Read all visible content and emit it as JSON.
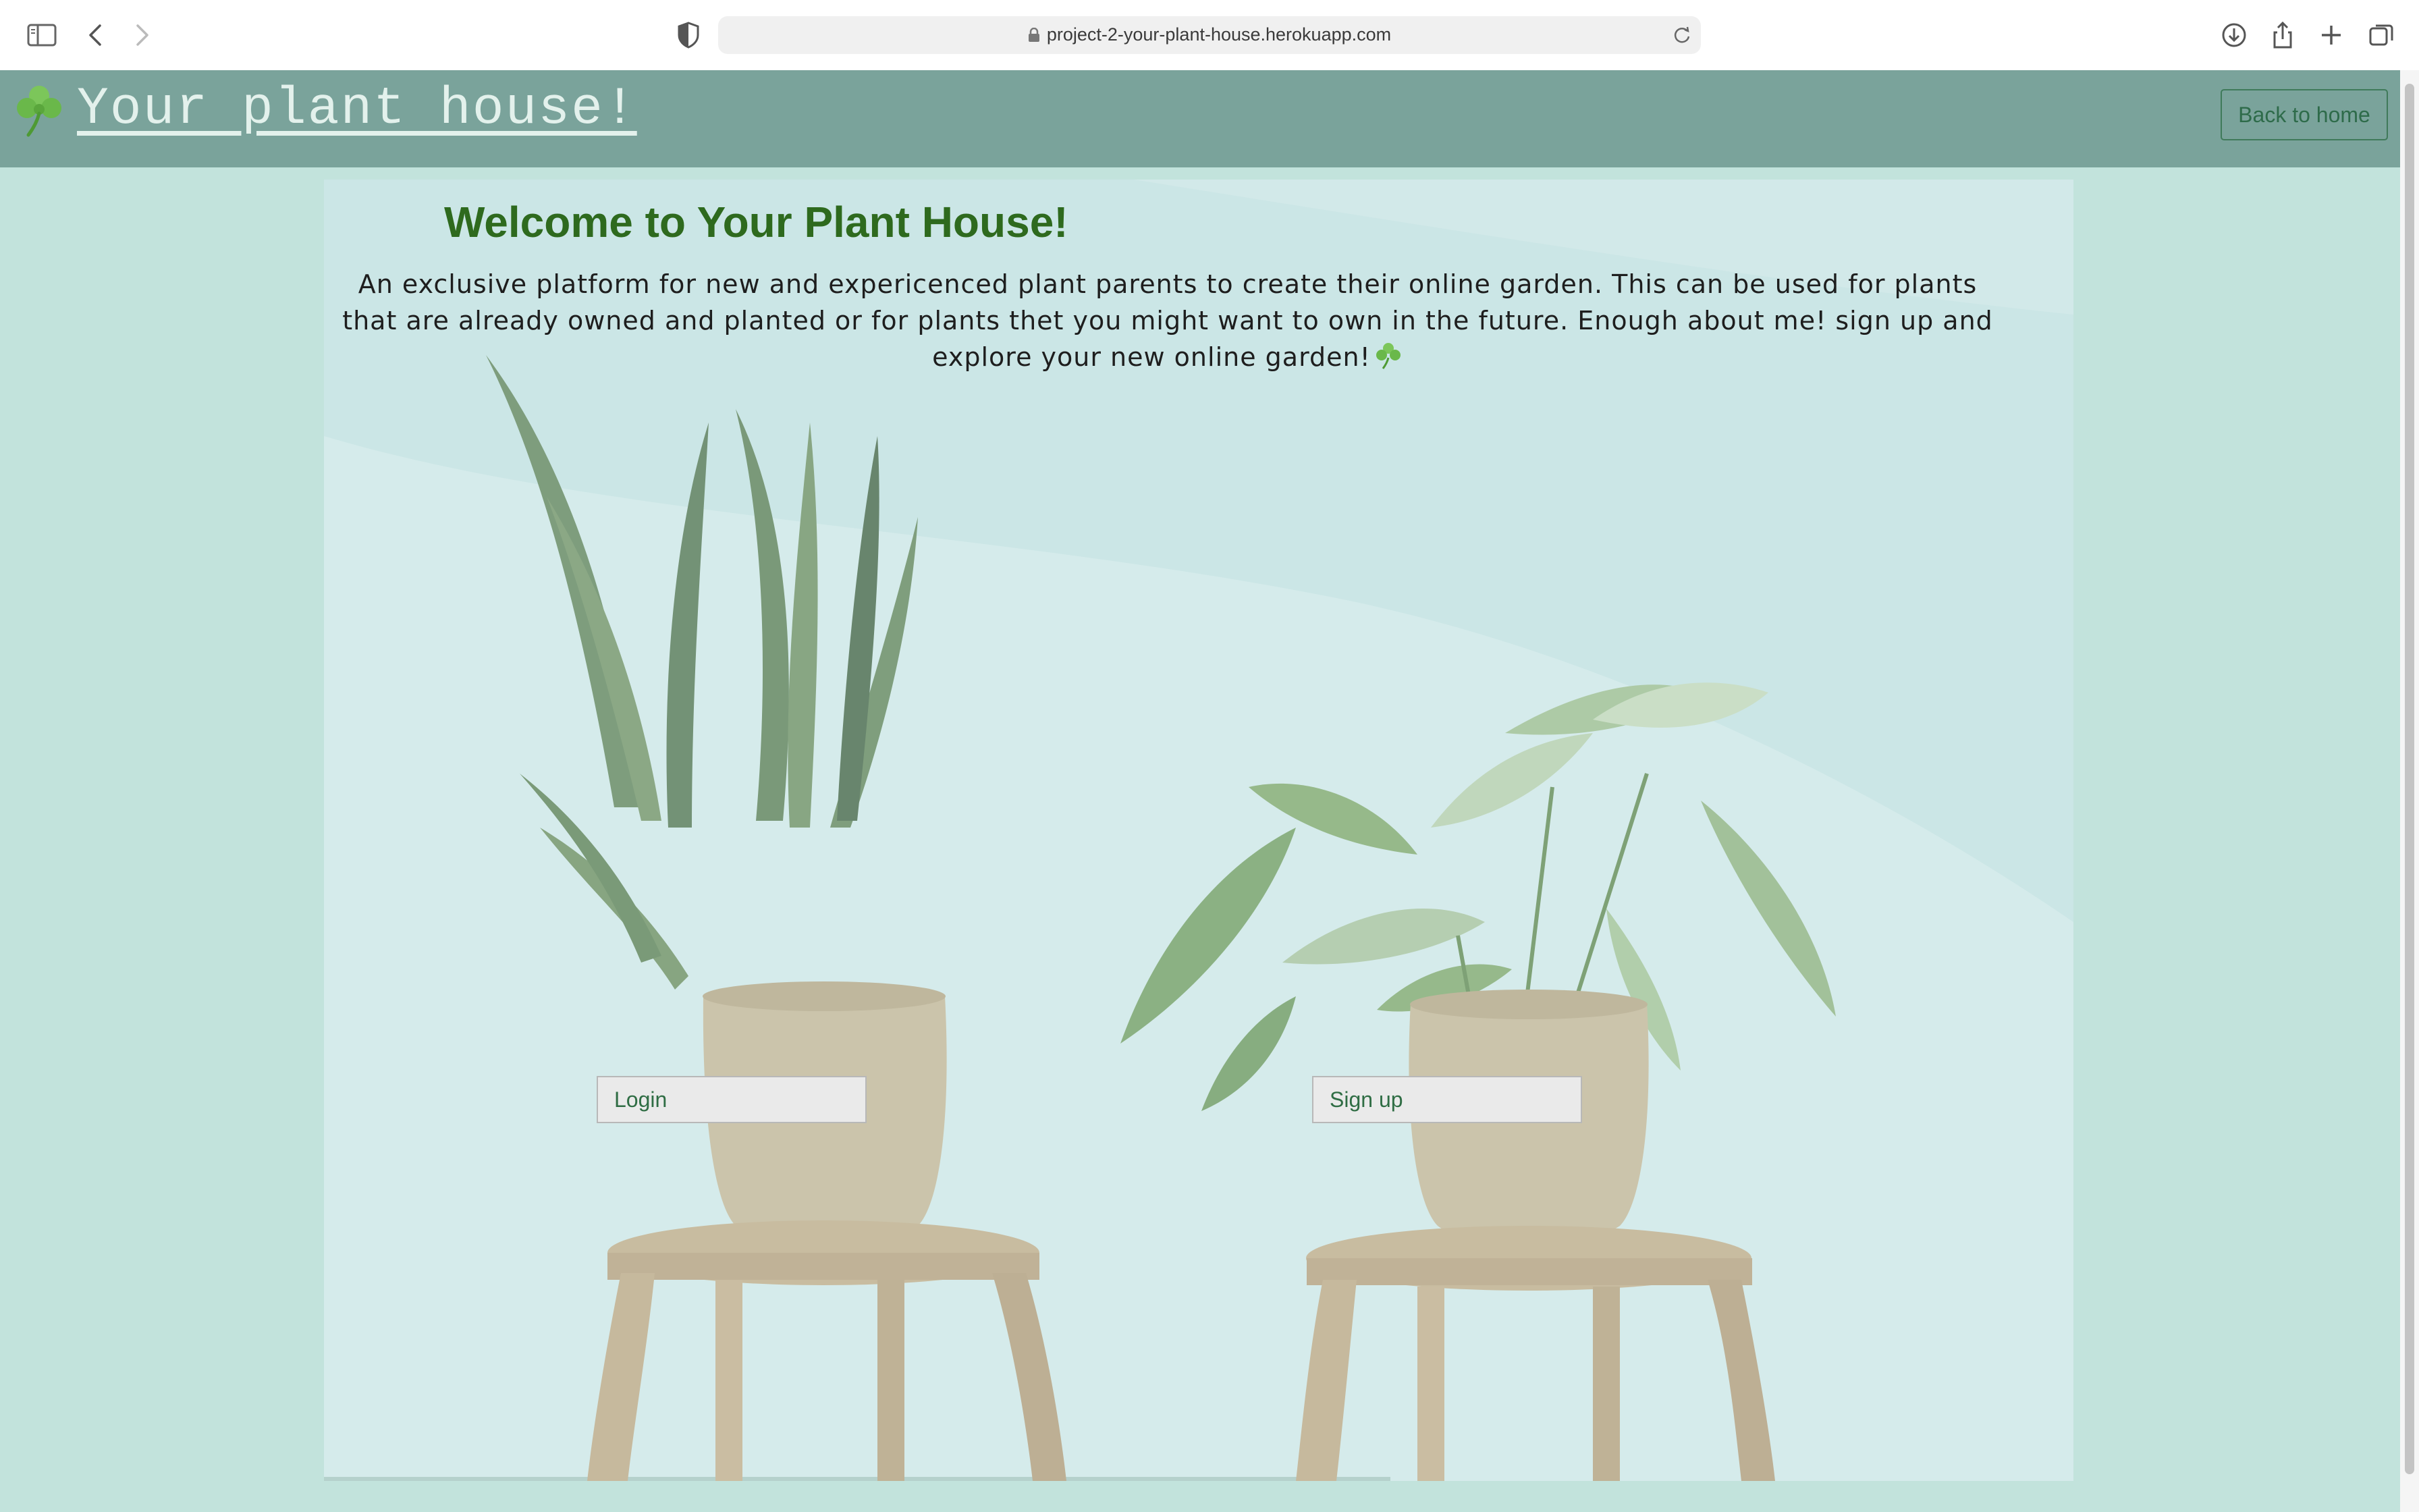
{
  "browser": {
    "url": "project-2-your-plant-house.herokuapp.com",
    "icons": [
      "sidebar-toggle-icon",
      "back-arrow-icon",
      "forward-arrow-icon",
      "shield-icon",
      "lock-icon",
      "reload-icon",
      "download-icon",
      "share-icon",
      "new-tab-icon",
      "tab-overview-icon"
    ]
  },
  "header": {
    "brand_text": "Your plant house!",
    "brand_icon": "shamrock-icon",
    "back_home_label": "Back to home"
  },
  "main": {
    "title": "Welcome to Your Plant House!",
    "intro": "An exclusive platform for new and expericenced plant parents to create their online garden. This can be used for plants that are already owned and planted or for plants thet you might want to own in the future. Enough about me! sign up and explore your new online garden!",
    "intro_trailing_icon": "shamrock-icon",
    "login_label": "Login",
    "signup_label": "Sign up"
  },
  "colors": {
    "page_bg": "#c2e3dc",
    "header_bg": "#7aa39b",
    "title": "#2e6a1e",
    "button_text": "#2f6d44"
  }
}
